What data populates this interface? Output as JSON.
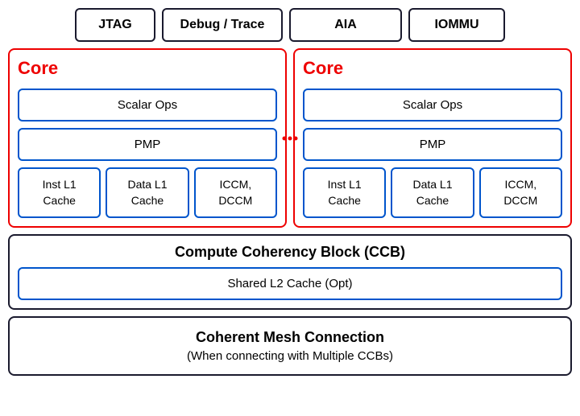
{
  "top_bar": {
    "boxes": [
      {
        "id": "jtag",
        "label": "JTAG"
      },
      {
        "id": "debug",
        "label": "Debug / Trace"
      },
      {
        "id": "aia",
        "label": "AIA"
      },
      {
        "id": "iommu",
        "label": "IOMMU"
      }
    ]
  },
  "cores": [
    {
      "id": "core-left",
      "title": "Core",
      "scalar_ops": "Scalar Ops",
      "pmp": "PMP",
      "cache_items": [
        {
          "id": "inst-l1-left",
          "label": "Inst L1\nCache"
        },
        {
          "id": "data-l1-left",
          "label": "Data L1\nCache"
        },
        {
          "id": "iccm-left",
          "label": "ICCM,\nDCCM"
        }
      ]
    },
    {
      "id": "core-right",
      "title": "Core",
      "scalar_ops": "Scalar Ops",
      "pmp": "PMP",
      "cache_items": [
        {
          "id": "inst-l1-right",
          "label": "Inst L1\nCache"
        },
        {
          "id": "data-l1-right",
          "label": "Data L1\nCache"
        },
        {
          "id": "iccm-right",
          "label": "ICCM,\nDCCM"
        }
      ]
    }
  ],
  "ccb": {
    "title": "Compute Coherency Block (CCB)",
    "shared_cache": "Shared L2 Cache (Opt)"
  },
  "mesh": {
    "title": "Coherent Mesh Connection",
    "subtitle": "(When connecting with Multiple CCBs)"
  }
}
